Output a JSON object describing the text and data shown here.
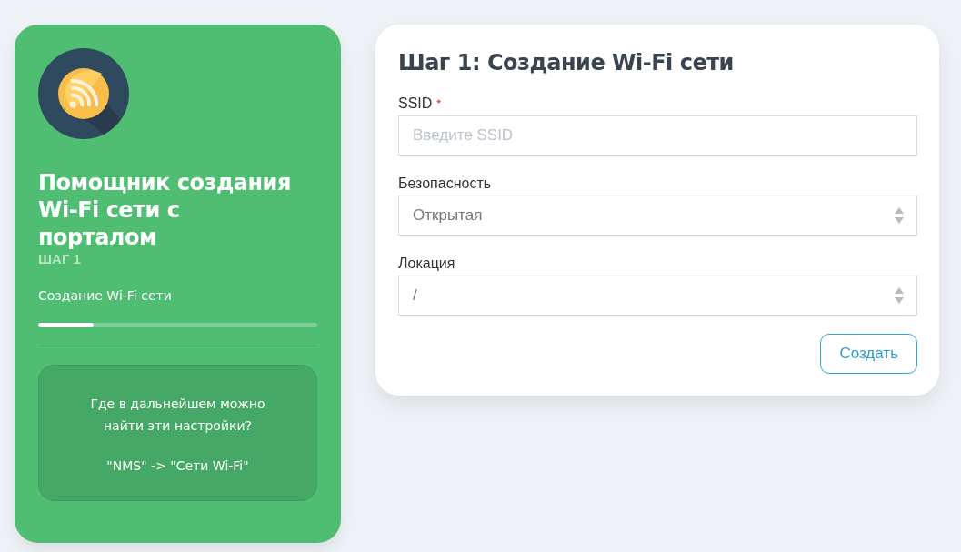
{
  "sidebar": {
    "title": "Помощник создания Wi-Fi сети с порталом",
    "step_label": "ШАГ 1",
    "step_name": "Создание Wi-Fi сети",
    "progress": {
      "level": 0.2
    },
    "info": {
      "question": "Где в дальнейшем можно найти эти настройки?",
      "path": "\"NMS\" -> \"Сети Wi-Fi\""
    }
  },
  "form": {
    "title": "Шаг 1: Создание Wi-Fi сети",
    "fields": [
      {
        "kind": "text",
        "label": "SSID",
        "required": true,
        "placeholder": "Введите SSID"
      },
      {
        "kind": "select",
        "label": "Безопасность",
        "required": false,
        "value": "Открытая"
      },
      {
        "kind": "select",
        "label": "Локация",
        "required": false,
        "value": "/"
      }
    ],
    "submit": "Создать"
  }
}
